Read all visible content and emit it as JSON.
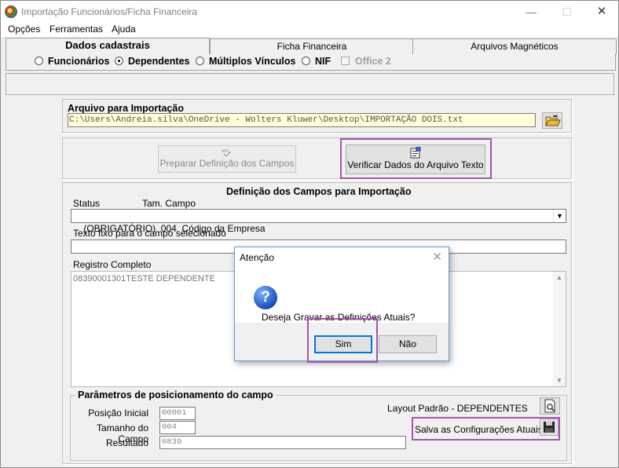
{
  "window": {
    "title": "Importação Funcionários/Ficha Financeira",
    "min": "—",
    "max": "☐",
    "close": "✕"
  },
  "menu": [
    "Opções",
    "Ferramentas",
    "Ajuda"
  ],
  "tabs": [
    {
      "label": "Dados cadastrais",
      "active": true
    },
    {
      "label": "Ficha Financeira",
      "active": false
    },
    {
      "label": "Arquivos Magnéticos",
      "active": false
    }
  ],
  "options": {
    "radios": [
      {
        "label": "Funcionários",
        "checked": false
      },
      {
        "label": "Dependentes",
        "checked": true
      },
      {
        "label": "Múltiplos Vínculos",
        "checked": false
      },
      {
        "label": "NIF",
        "checked": false
      }
    ],
    "office2_label": "Office 2"
  },
  "arquivo": {
    "label": "Arquivo para Importação",
    "path": "C:\\Users\\Andreia.silva\\OneDrive - Wolters Kluwer\\Desktop\\IMPORTAÇÃO DOIS.txt",
    "open_icon": "folder-open-icon"
  },
  "buttons": {
    "preparar": "Preparar Definição dos Campos",
    "preparar_icon_text": "ABC",
    "verificar": "Verificar Dados do Arquivo Texto"
  },
  "definicao": {
    "title": "Definição dos Campos para Importação",
    "status_label": "Status",
    "tam_label": "Tam. Campo",
    "selected_field": "(OBRIGATÓRIO)  004  Código da Empresa",
    "texto_fixo_label": "Texto fixo para o campo selecionado",
    "texto_fixo_value": "",
    "registro_label": "Registro Completo",
    "registro_value": "08390001301TESTE DEPENDENTE"
  },
  "parametros": {
    "title": "Parâmetros de posicionamento do campo",
    "posicao_label": "Posição Inicial",
    "posicao_value": "00001",
    "tamanho_label": "Tamanho do Campo",
    "tamanho_value": "004",
    "resultado_label": "Resultado",
    "resultado_value": "0839",
    "layout_label": "Layout Padrão - DEPENDENTES",
    "salva_label": "Salva as Configurações Atuais?"
  },
  "dialog": {
    "title": "Atenção",
    "message": "Deseja Gravar as Definições Atuais?",
    "yes": "Sim",
    "no": "Não",
    "icon": "?"
  },
  "colors": {
    "highlight": "#a555b0",
    "path_bg": "#ffffd7",
    "dialog_border": "#6b9bd1"
  }
}
